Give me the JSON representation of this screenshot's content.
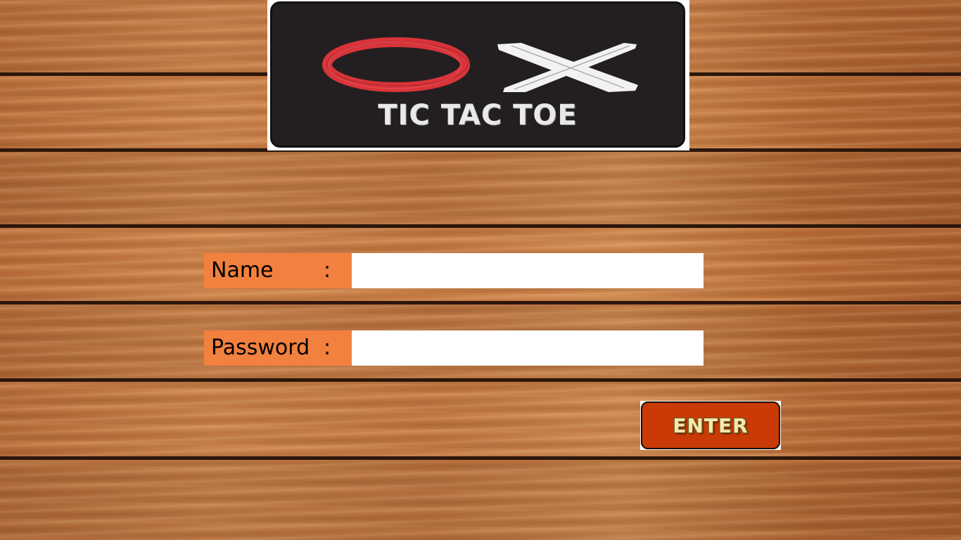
{
  "logo": {
    "title": "TIC TAC TOE",
    "icons": [
      "o-ring-icon",
      "x-cross-icon"
    ],
    "colors": {
      "o": "#d9343a",
      "x": "#f2f2f2",
      "background": "#231f20"
    }
  },
  "form": {
    "name_label": "Name",
    "name_colon": ":",
    "name_value": "",
    "password_label": "Password",
    "password_colon": ":",
    "password_value": ""
  },
  "enter_button": {
    "label": "ENTER",
    "color": "#c93a06"
  },
  "colors": {
    "label_bg": "#f2803e",
    "wood": "#b8713f"
  }
}
